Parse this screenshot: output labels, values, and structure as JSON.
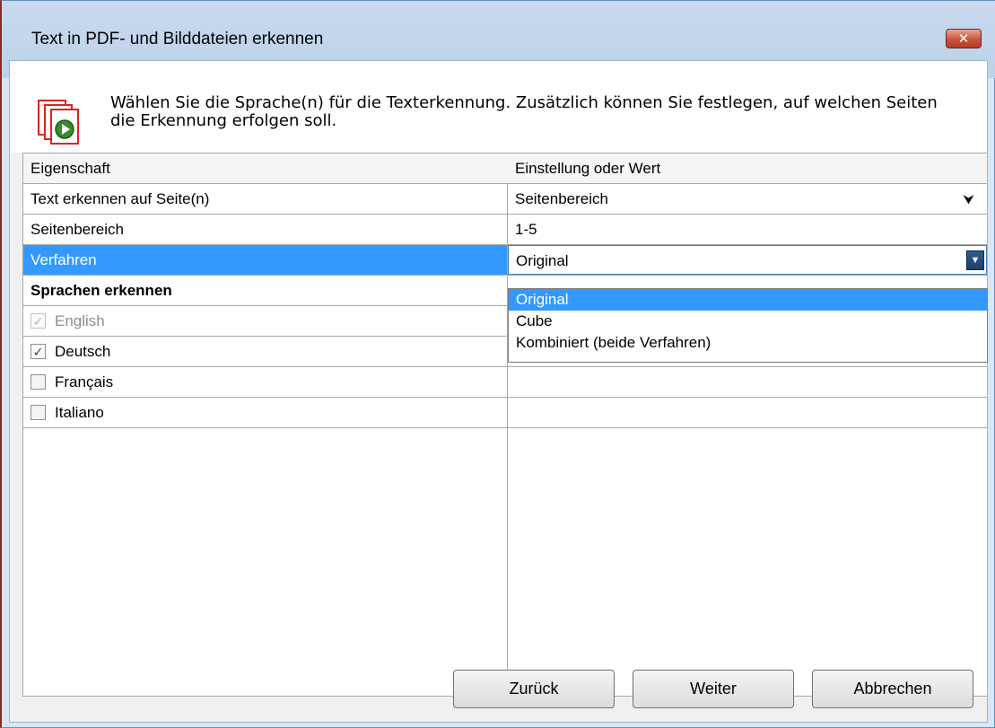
{
  "window": {
    "title": "Text in PDF- und Bilddateien erkennen",
    "close_label": "✕"
  },
  "header": {
    "description": "Wählen Sie die Sprache(n) für die Texterkennung. Zusätzlich können Sie festlegen, auf welchen Seiten die Erkennung erfolgen soll.",
    "icon": "pdf-play-icon"
  },
  "grid": {
    "columns": [
      "Eigenschaft",
      "Einstellung oder Wert"
    ],
    "rows": [
      {
        "property": "Text erkennen auf Seite(n)",
        "value": "Seitenbereich"
      },
      {
        "property": "Seitenbereich",
        "value": "1-5"
      },
      {
        "property": "Verfahren",
        "value": "Original"
      }
    ],
    "languages_header": "Sprachen erkennen",
    "languages": [
      {
        "label": "English",
        "checked": true,
        "disabled": true
      },
      {
        "label": "Deutsch",
        "checked": true,
        "disabled": false
      },
      {
        "label": "Français",
        "checked": false,
        "disabled": false
      },
      {
        "label": "Italiano",
        "checked": false,
        "disabled": false
      }
    ]
  },
  "dropdown": {
    "options": [
      "Original",
      "Cube",
      "Kombiniert (beide Verfahren)"
    ],
    "selected": "Original"
  },
  "buttons": {
    "back": "Zurück",
    "next": "Weiter",
    "cancel": "Abbrechen"
  },
  "colors": {
    "selection": "#3399ff",
    "titlebar": "#c9daee",
    "close_button": "#c8533c"
  }
}
